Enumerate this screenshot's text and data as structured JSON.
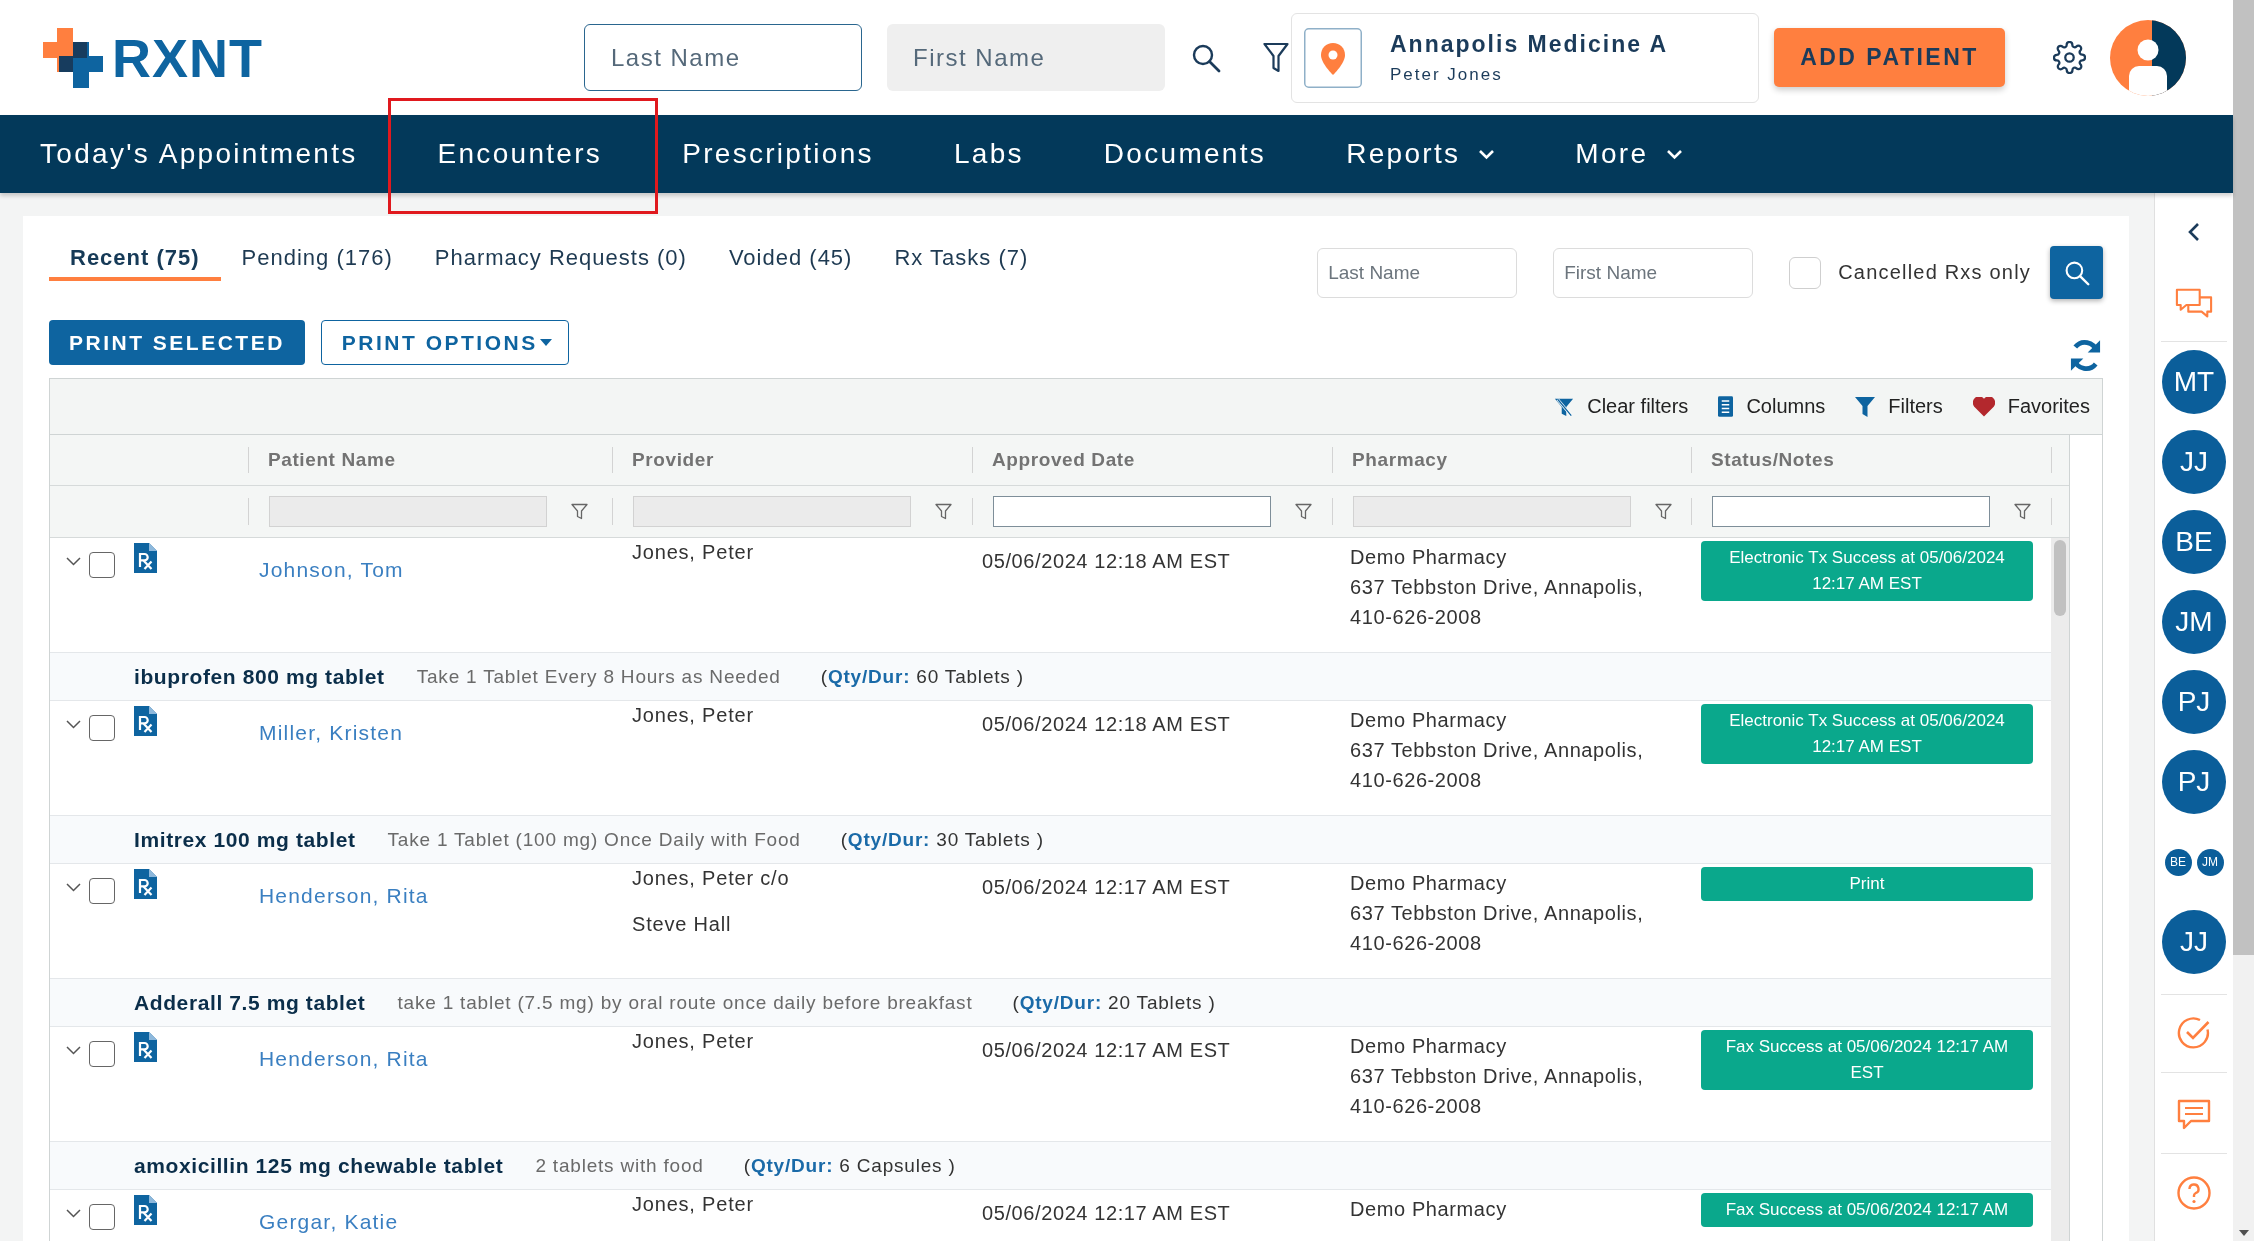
{
  "header": {
    "logo": "RXNT",
    "last_name": {
      "placeholder": "Last Name"
    },
    "first_name": {
      "placeholder": "First Name"
    },
    "location": {
      "name": "Annapolis Medicine A",
      "user": "Peter Jones"
    },
    "add_patient": "ADD PATIENT"
  },
  "nav": [
    {
      "label": "Today's Appointments",
      "dropdown": false,
      "highlighted": false
    },
    {
      "label": "Encounters",
      "dropdown": false,
      "highlighted": true
    },
    {
      "label": "Prescriptions",
      "dropdown": false,
      "highlighted": false
    },
    {
      "label": "Labs",
      "dropdown": false,
      "highlighted": false
    },
    {
      "label": "Documents",
      "dropdown": false,
      "highlighted": false
    },
    {
      "label": "Reports",
      "dropdown": true,
      "highlighted": false
    },
    {
      "label": "More",
      "dropdown": true,
      "highlighted": false
    }
  ],
  "tabs": [
    {
      "label": "Recent (75)",
      "selected": true
    },
    {
      "label": "Pending (176)",
      "selected": false
    },
    {
      "label": "Pharmacy Requests (0)",
      "selected": false
    },
    {
      "label": "Voided (45)",
      "selected": false
    },
    {
      "label": "Rx Tasks (7)",
      "selected": false
    }
  ],
  "search": {
    "last_name": {
      "placeholder": "Last Name"
    },
    "first_name": {
      "placeholder": "First Name"
    },
    "cancelled_only": {
      "label": "Cancelled Rxs only",
      "checked": false
    }
  },
  "actions": {
    "print_selected": "PRINT SELECTED",
    "print_options": "PRINT OPTIONS"
  },
  "grid": {
    "toolbar": [
      {
        "kind": "clear_filters",
        "label": "Clear filters"
      },
      {
        "kind": "columns",
        "label": "Columns"
      },
      {
        "kind": "filters",
        "label": "Filters"
      },
      {
        "kind": "favorites",
        "label": "Favorites"
      }
    ],
    "columns": [
      {
        "label": "Patient Name",
        "filter_disabled": true
      },
      {
        "label": "Provider",
        "filter_disabled": true
      },
      {
        "label": "Approved Date",
        "filter_disabled": false
      },
      {
        "label": "Pharmacy",
        "filter_disabled": true
      },
      {
        "label": "Status/Notes",
        "filter_disabled": false
      }
    ],
    "rows": [
      {
        "checked": false,
        "patient": "Johnson, Tom",
        "provider": [
          "Jones, Peter"
        ],
        "approved": "05/06/2024 12:18 AM EST",
        "pharmacy": [
          "Demo Pharmacy",
          "637 Tebbston Drive, Annapolis,",
          "410-626-2008"
        ],
        "status": "Electronic Tx Success at 05/06/2024 12:17 AM EST",
        "drug": {
          "name": "ibuprofen 800 mg tablet",
          "sig": "Take 1 Tablet Every 8 Hours as Needed",
          "qty": "(**Qty/Dur:** 60 Tablets )"
        }
      },
      {
        "checked": false,
        "patient": "Miller, Kristen",
        "provider": [
          "Jones, Peter"
        ],
        "approved": "05/06/2024 12:18 AM EST",
        "pharmacy": [
          "Demo Pharmacy",
          "637 Tebbston Drive, Annapolis,",
          "410-626-2008"
        ],
        "status": "Electronic Tx Success at 05/06/2024 12:17 AM EST",
        "drug": {
          "name": "Imitrex 100 mg tablet",
          "sig": "Take 1 Tablet (100 mg) Once Daily with Food",
          "qty": "(**Qty/Dur:** 30 Tablets )"
        }
      },
      {
        "checked": false,
        "patient": "Henderson, Rita",
        "provider": [
          "Jones, Peter c/o",
          "Steve Hall"
        ],
        "approved": "05/06/2024 12:17 AM EST",
        "pharmacy": [
          "Demo Pharmacy",
          "637 Tebbston Drive, Annapolis,",
          "410-626-2008"
        ],
        "status": "Print",
        "drug": {
          "name": "Adderall 7.5 mg tablet",
          "sig": "take 1 tablet (7.5 mg) by oral route once daily before breakfast",
          "qty": "(**Qty/Dur:** 20 Tablets )"
        }
      },
      {
        "checked": false,
        "patient": "Henderson, Rita",
        "provider": [
          "Jones, Peter"
        ],
        "approved": "05/06/2024 12:17 AM EST",
        "pharmacy": [
          "Demo Pharmacy",
          "637 Tebbston Drive, Annapolis,",
          "410-626-2008"
        ],
        "status": "Fax Success at 05/06/2024 12:17 AM EST",
        "drug": {
          "name": "amoxicillin 125 mg chewable tablet",
          "sig": "2 tablets with food",
          "qty": "(**Qty/Dur:** 6 Capsules )"
        }
      },
      {
        "checked": false,
        "patient": "Gergar, Katie",
        "provider": [
          "Jones, Peter"
        ],
        "approved": "05/06/2024 12:17 AM EST",
        "pharmacy": [
          "Demo Pharmacy"
        ],
        "status": "Fax Success at 05/06/2024 12:17 AM"
      }
    ]
  },
  "sidebar": {
    "avatars": [
      {
        "kind": "single",
        "initials": "MT"
      },
      {
        "kind": "single",
        "initials": "JJ"
      },
      {
        "kind": "single",
        "initials": "BE"
      },
      {
        "kind": "single",
        "initials": "JM"
      },
      {
        "kind": "single",
        "initials": "PJ"
      },
      {
        "kind": "single",
        "initials": "PJ"
      },
      {
        "kind": "pair",
        "members": [
          {
            "initials": "BE"
          },
          {
            "initials": "JM"
          }
        ]
      },
      {
        "kind": "single",
        "initials": "JJ"
      }
    ]
  }
}
